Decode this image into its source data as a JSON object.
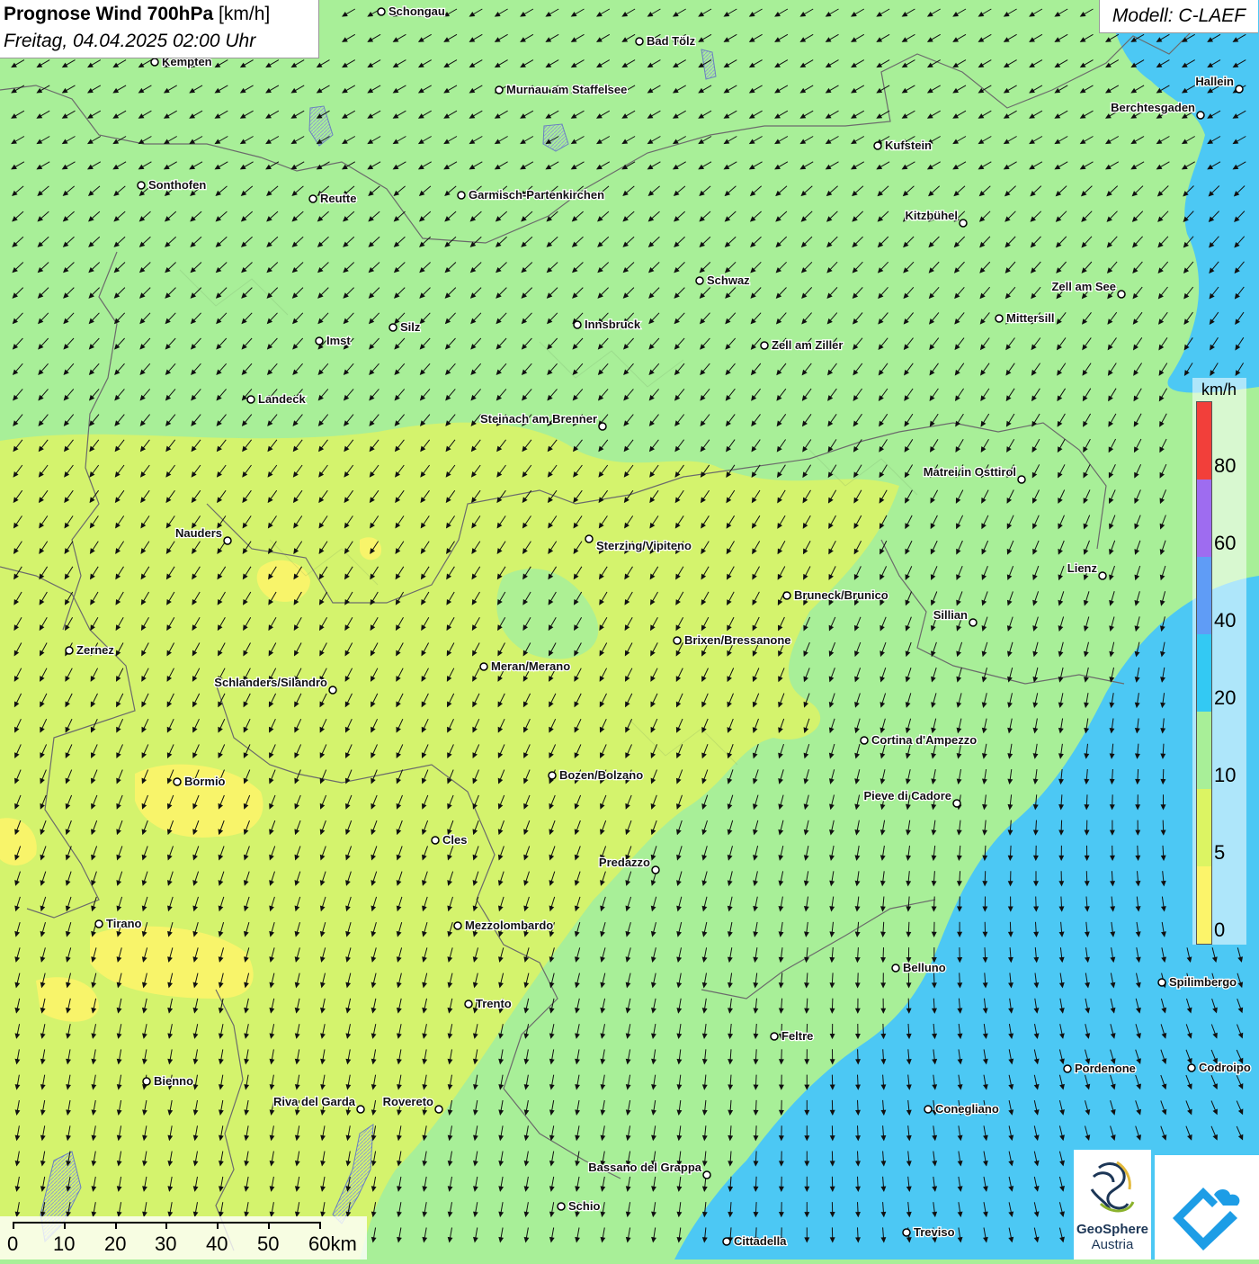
{
  "title": {
    "bold": "Prognose Wind 700hPa",
    "unit": "[km/h]",
    "datetime": "Freitag, 04.04.2025 02:00 Uhr"
  },
  "model": "Modell: C-LAEF",
  "legend": {
    "unit": "km/h",
    "labels": [
      "80",
      "60",
      "40",
      "20",
      "10",
      "5",
      "0"
    ],
    "colors": [
      "#f23f3a",
      "#9e6cf0",
      "#5f9cf6",
      "#33c9f3",
      "#a8ef98",
      "#dcf463",
      "#fcf46a"
    ]
  },
  "scale": {
    "labels": [
      "0",
      "10",
      "20",
      "30",
      "40",
      "50",
      "60km"
    ]
  },
  "logo": {
    "name": "GeoSphere",
    "sub": "Austria"
  },
  "cities": [
    {
      "name": "Schongau"
    },
    {
      "name": "Bad Tölz"
    },
    {
      "name": "Kempten"
    },
    {
      "name": "Murnau am Staffelsee"
    },
    {
      "name": "Hallein"
    },
    {
      "name": "Berchtesgaden"
    },
    {
      "name": "Kufstein"
    },
    {
      "name": "Sonthofen"
    },
    {
      "name": "Reutte"
    },
    {
      "name": "Garmisch-Partenkirchen"
    },
    {
      "name": "Kitzbühel"
    },
    {
      "name": "Schwaz"
    },
    {
      "name": "Zell am See"
    },
    {
      "name": "Mittersill"
    },
    {
      "name": "Innsbruck"
    },
    {
      "name": "Silz"
    },
    {
      "name": "Imst"
    },
    {
      "name": "Zell am Ziller"
    },
    {
      "name": "Landeck"
    },
    {
      "name": "Steinach am Brenner"
    },
    {
      "name": "Matrei in Osttirol"
    },
    {
      "name": "Nauders"
    },
    {
      "name": "Sterzing/Vipiteno"
    },
    {
      "name": "Lienz"
    },
    {
      "name": "Bruneck/Brunico"
    },
    {
      "name": "Sillian"
    },
    {
      "name": "Brixen/Bressanone"
    },
    {
      "name": "Zernez"
    },
    {
      "name": "Meran/Merano"
    },
    {
      "name": "Schlanders/Silandro"
    },
    {
      "name": "Cortina d'Ampezzo"
    },
    {
      "name": "Bormio"
    },
    {
      "name": "Bozen/Bolzano"
    },
    {
      "name": "Pieve di Cadore"
    },
    {
      "name": "Cles"
    },
    {
      "name": "Predazzo"
    },
    {
      "name": "Tirano"
    },
    {
      "name": "Mezzolombardo"
    },
    {
      "name": "Belluno"
    },
    {
      "name": "Spilimbergo"
    },
    {
      "name": "Trento"
    },
    {
      "name": "Feltre"
    },
    {
      "name": "Pordenone"
    },
    {
      "name": "Codroipo"
    },
    {
      "name": "Bienno"
    },
    {
      "name": "Riva del Garda"
    },
    {
      "name": "Rovereto"
    },
    {
      "name": "Conegliano"
    },
    {
      "name": "Bassano del Grappa"
    },
    {
      "name": "Schio"
    },
    {
      "name": "Treviso"
    },
    {
      "name": "Cittadella"
    }
  ]
}
